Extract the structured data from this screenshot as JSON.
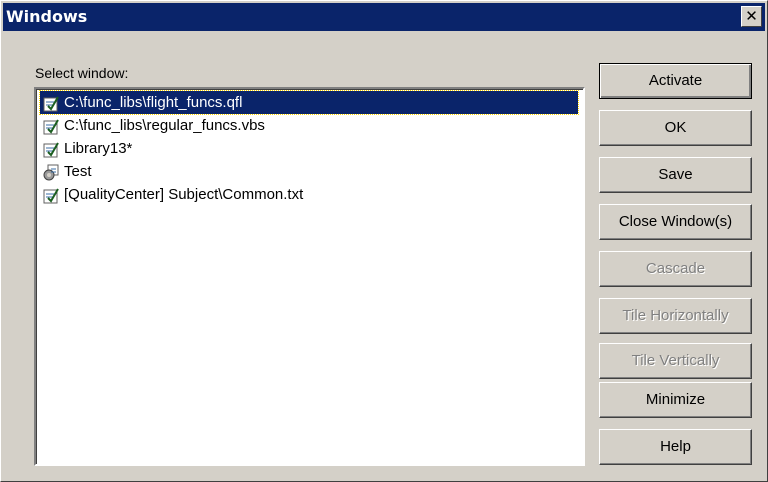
{
  "dialog": {
    "title": "Windows",
    "close_glyph": "✕"
  },
  "label": "Select window:",
  "items": [
    {
      "label": "C:\\func_libs\\flight_funcs.qfl",
      "icon": "function-library-icon",
      "selected": true
    },
    {
      "label": "C:\\func_libs\\regular_funcs.vbs",
      "icon": "function-library-icon",
      "selected": false
    },
    {
      "label": "Library13*",
      "icon": "function-library-icon",
      "selected": false
    },
    {
      "label": "Test",
      "icon": "test-icon",
      "selected": false
    },
    {
      "label": "[QualityCenter] Subject\\Common.txt",
      "icon": "function-library-icon",
      "selected": false
    }
  ],
  "buttons": {
    "activate": "Activate",
    "ok": "OK",
    "save": "Save",
    "close_windows": "Close Window(s)",
    "cascade": "Cascade",
    "tile_horizontally": "Tile Horizontally",
    "tile_vertically": "Tile Vertically",
    "minimize": "Minimize",
    "help": "Help"
  },
  "colors": {
    "titlebar": "#0a246a",
    "face": "#d4d0c8",
    "selection": "#0a246a"
  }
}
